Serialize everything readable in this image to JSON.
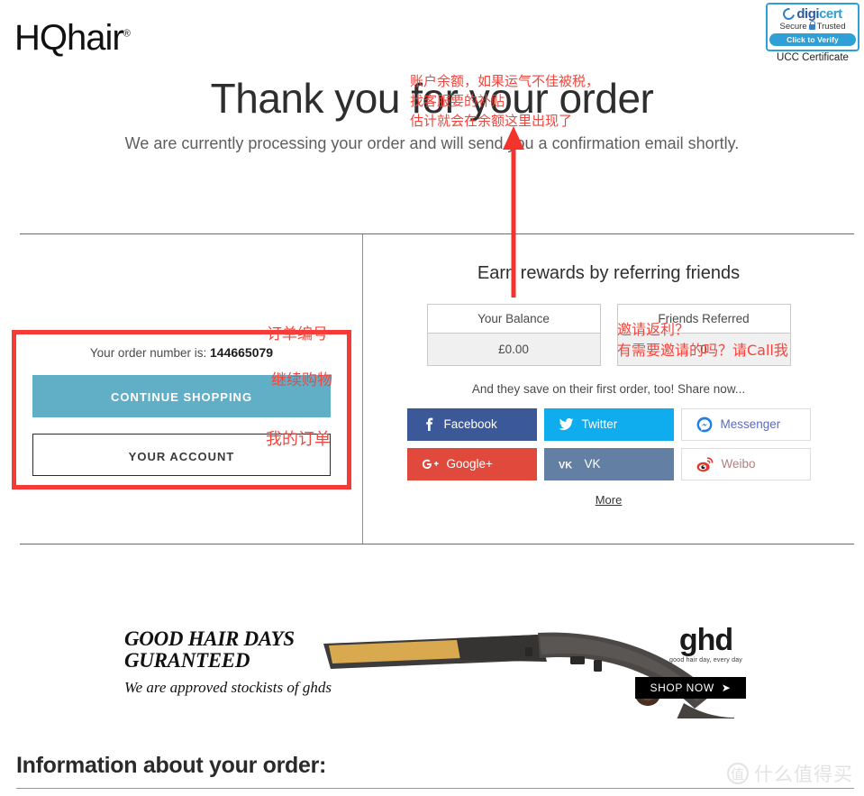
{
  "header": {
    "logo_text": "HQhair",
    "logo_registered": "®",
    "digicert": {
      "brand_part1": "digi",
      "brand_part2": "cert",
      "secure_text": "Secure",
      "trusted_text": "Trusted",
      "verify_label": "Click to Verify",
      "caption": "UCC Certificate",
      "accent_color": "#2f9fd6"
    }
  },
  "hero": {
    "title": "Thank you for your order",
    "subtitle": "We are currently processing your order and will send you a confirmation email shortly."
  },
  "order_panel": {
    "order_number_prefix": "Your order number is:",
    "order_number": "144665079",
    "continue_shopping_label": "CONTINUE SHOPPING",
    "your_account_label": "YOUR ACCOUNT",
    "continue_shopping_color": "#61afc7",
    "highlight_color": "#f53a37"
  },
  "rewards": {
    "title": "Earn rewards by referring friends",
    "stats": [
      {
        "label": "Your Balance",
        "value": "£0.00"
      },
      {
        "label": "Friends Referred",
        "value": "0"
      }
    ],
    "share_subtitle": "And they save on their first order, too! Share now...",
    "social_buttons": [
      {
        "name": "Facebook",
        "icon": "facebook-icon",
        "color": "#3b5998"
      },
      {
        "name": "Twitter",
        "icon": "twitter-icon",
        "color": "#10adee"
      },
      {
        "name": "Messenger",
        "icon": "messenger-icon",
        "color": "#ffffff"
      },
      {
        "name": "Google+",
        "icon": "googleplus-icon",
        "color": "#e0493c"
      },
      {
        "name": "VK",
        "icon": "vk-icon",
        "color": "#647fa4"
      },
      {
        "name": "Weibo",
        "icon": "weibo-icon",
        "color": "#ffffff"
      }
    ],
    "more_label": "More"
  },
  "annotations": {
    "color": "#f2453d",
    "balance_note": "账户余额，如果运气不佳被税，\n找客服要的补贴\n估计就会在余额这里出现了",
    "order_number_note": "订单编号",
    "continue_shopping_note": "继续购物",
    "your_account_note": "我的订单",
    "referral_note": "邀请返利？\n有需要邀请的吗？请Call我"
  },
  "banner": {
    "headline_line1": "GOOD HAIR DAYS",
    "headline_line2": "GURANTEED",
    "subline": "We are approved stockists of ghds",
    "brand": "ghd",
    "brand_tagline": "good hair day, every day",
    "cta_label": "SHOP NOW",
    "cta_arrow": "➤"
  },
  "footer": {
    "order_info_heading": "Information about your order:",
    "watermark_mark": "值",
    "watermark_text": "什么值得买"
  }
}
